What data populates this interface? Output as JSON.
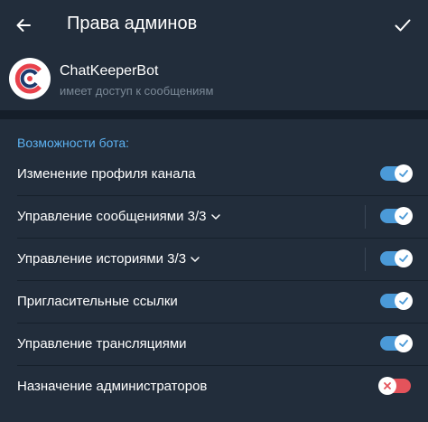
{
  "header": {
    "title": "Права админов",
    "back_icon": "arrow-left-icon",
    "confirm_icon": "check-icon"
  },
  "bot": {
    "name": "ChatKeeperBot",
    "subtitle": "имеет доступ к сообщениям",
    "avatar_icon": "chatkeeper-logo-icon"
  },
  "permissions": {
    "section_title": "Возможности бота:",
    "items": [
      {
        "label": "Изменение профиля канала",
        "enabled": true,
        "expandable": false
      },
      {
        "label": "Управление сообщениями 3/3",
        "enabled": true,
        "expandable": true
      },
      {
        "label": "Управление историями 3/3",
        "enabled": true,
        "expandable": true
      },
      {
        "label": "Пригласительные ссылки",
        "enabled": true,
        "expandable": false
      },
      {
        "label": "Управление трансляциями",
        "enabled": true,
        "expandable": false
      },
      {
        "label": "Назначение администраторов",
        "enabled": false,
        "expandable": false
      }
    ]
  },
  "colors": {
    "accent": "#5db2f2",
    "toggle_on": "#4b9ad8",
    "toggle_off": "#e4535b",
    "background": "#222d3b"
  }
}
